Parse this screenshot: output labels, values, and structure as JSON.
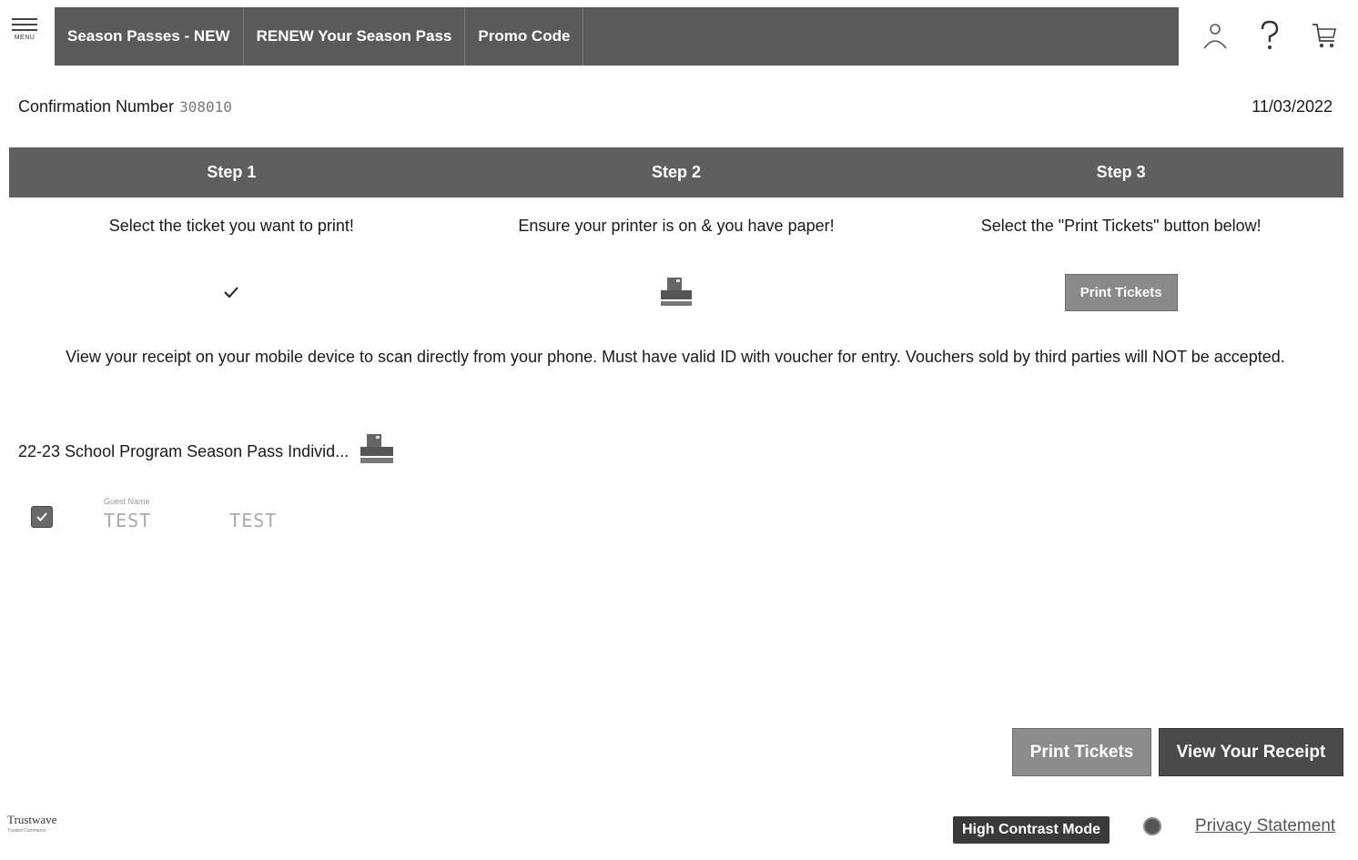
{
  "menu": {
    "label": "MENU",
    "icon": "hamburger-icon"
  },
  "nav": {
    "items": [
      {
        "label": "Season Passes - NEW"
      },
      {
        "label": "RENEW Your Season Pass"
      },
      {
        "label": "Promo Code"
      }
    ],
    "background": "#5a5a5a"
  },
  "utility": {
    "icons": [
      "account-icon",
      "help-icon",
      "cart-icon"
    ]
  },
  "confirmation": {
    "label": "Confirmation Number",
    "number": "308010",
    "date": "11/03/2022"
  },
  "steps": [
    {
      "title": "Step 1",
      "description": "Select the ticket you want to print!",
      "icon": "checkmark-icon"
    },
    {
      "title": "Step 2",
      "description": "Ensure your printer is on & you have paper!",
      "icon": "printer-icon"
    },
    {
      "title": "Step 3",
      "description": "Select the \"Print Tickets\" button below!",
      "button_label": "Print Tickets"
    }
  ],
  "notice": "View your receipt on your mobile device to scan directly from your phone. Must have valid ID with voucher for entry. Vouchers sold by third parties will NOT be accepted.",
  "ticket": {
    "title": "22-23 School Program Season Pass Individ...",
    "guest_label": "Guest Name",
    "first_name": "TEST",
    "last_name": "TEST",
    "checked": true
  },
  "actions": {
    "print_label": "Print Tickets",
    "receipt_label": "View Your Receipt"
  },
  "footer": {
    "trust_name": "Trustwave",
    "trust_sub": "Trusted Commerce",
    "high_contrast_label": "High Contrast Mode",
    "privacy_label": "Privacy Statement"
  }
}
